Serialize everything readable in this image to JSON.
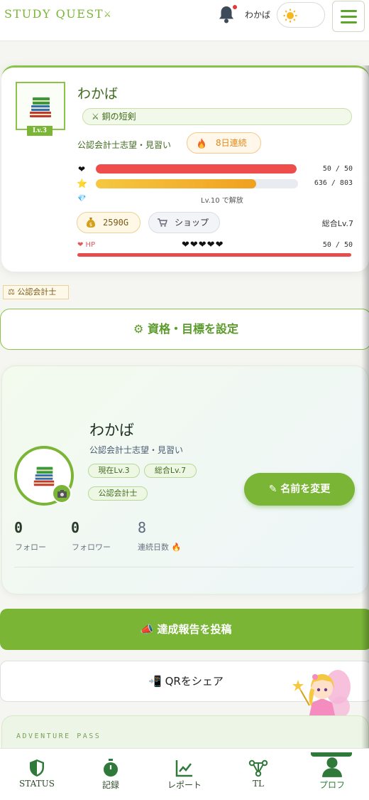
{
  "header": {
    "logo": "STUDY QUEST",
    "logo_mark": "⚔",
    "user_name": "わかば"
  },
  "status": {
    "name": "わかば",
    "level_tag": "Lv.3",
    "weapon": "⚔ 銅の短剣",
    "goal": "公認会計士志望・見習い",
    "streak": "8日連続",
    "hp_icon": "❤",
    "hp_value": "50 / 50",
    "hp_fill": 1.0,
    "exp_icon": "⭐",
    "exp_value": "636 / 803",
    "exp_fill": 0.792,
    "gem_icon": "💎",
    "unlock_text": "Lv.10 で解放",
    "gold": "2590G",
    "shop_label": "ショップ",
    "total_level": "総合Lv.7",
    "hp_label": "❤ HP",
    "hearts": "❤❤❤❤❤",
    "hp_value2": "50 / 50"
  },
  "qualification_tag": "⚖ 公認会計士",
  "set_goal_button": "⚙ 資格・目標を設定",
  "profile": {
    "name": "わかば",
    "goal": "公認会計士志望・見習い",
    "chips": [
      "現在Lv.3",
      "総合Lv.7",
      "公認会計士"
    ],
    "rename_button": "✎ 名前を変更",
    "stats": [
      {
        "value": "0",
        "label": "フォロー"
      },
      {
        "value": "0",
        "label": "フォロワー"
      },
      {
        "value": "8",
        "label": "連続日数 🔥"
      }
    ]
  },
  "post_button": "📣  達成報告を投稿",
  "qr_button": "📲 QRをシェア",
  "adventure_pass": "ADVENTURE PASS",
  "nav": [
    {
      "label": "STATUS",
      "icon": "shield-icon"
    },
    {
      "label": "記録",
      "icon": "stopwatch-icon"
    },
    {
      "label": "レポート",
      "icon": "chart-icon"
    },
    {
      "label": "TL",
      "icon": "network-icon"
    },
    {
      "label": "プロフ",
      "icon": "user-icon"
    }
  ],
  "colors": {
    "brand": "#7ab536",
    "hp": "#e74c4c",
    "exp": "#f0b429",
    "nav_active": "#2f7a3a"
  }
}
